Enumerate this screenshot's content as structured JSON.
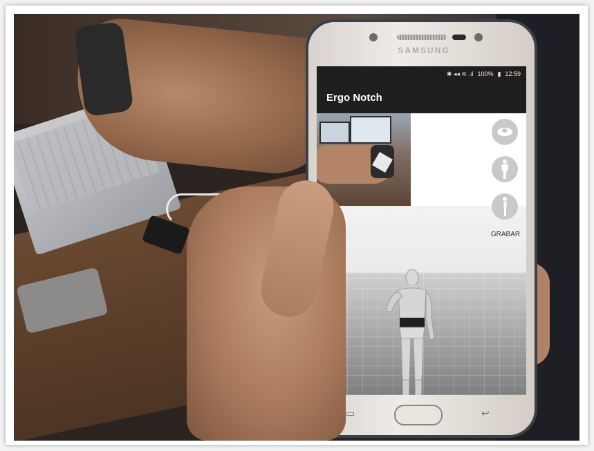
{
  "phone": {
    "brand": "SAMSUNG",
    "status": {
      "icons": "✱ ◂◂ ≋ .ıl",
      "battery": "100%",
      "time": "12:59"
    },
    "app": {
      "title": "Ergo Notch",
      "record_label": "GRABAR",
      "tools": [
        "top-view-icon",
        "front-view-icon",
        "side-view-icon"
      ]
    }
  }
}
